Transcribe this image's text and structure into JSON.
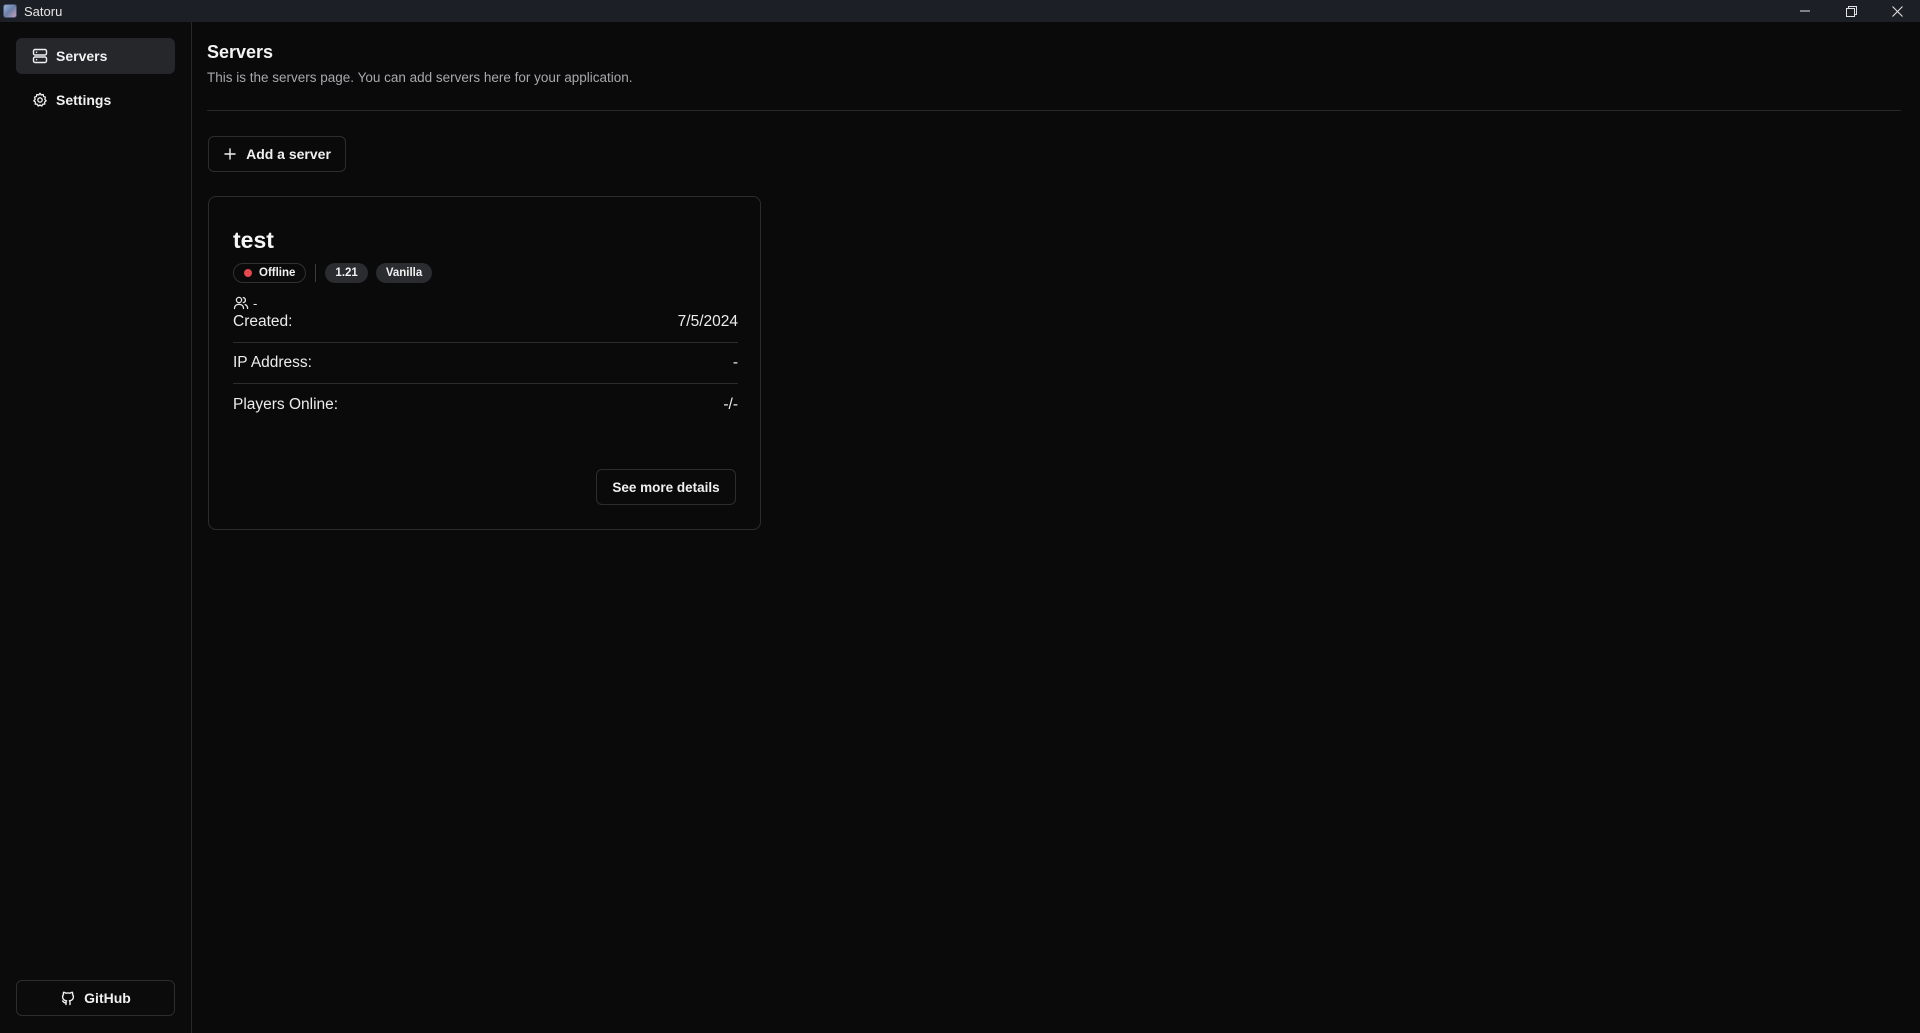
{
  "window": {
    "title": "Satoru",
    "icon": "app-logo-icon"
  },
  "sidebar": {
    "items": [
      {
        "label": "Servers",
        "icon": "server-icon",
        "active": true
      },
      {
        "label": "Settings",
        "icon": "gear-icon",
        "active": false
      }
    ],
    "github_label": "GitHub"
  },
  "page": {
    "title": "Servers",
    "description": "This is the servers page. You can add servers here for your application.",
    "add_button_label": "Add a server"
  },
  "server_card": {
    "name": "test",
    "status": "Offline",
    "status_color": "#e5484d",
    "version": "1.21",
    "type": "Vanilla",
    "players_short": "-",
    "rows": [
      {
        "label": "Created:",
        "value": "7/5/2024"
      },
      {
        "label": "IP Address:",
        "value": "-"
      },
      {
        "label": "Players Online:",
        "value": "-/-"
      }
    ],
    "details_button_label": "See more details"
  }
}
